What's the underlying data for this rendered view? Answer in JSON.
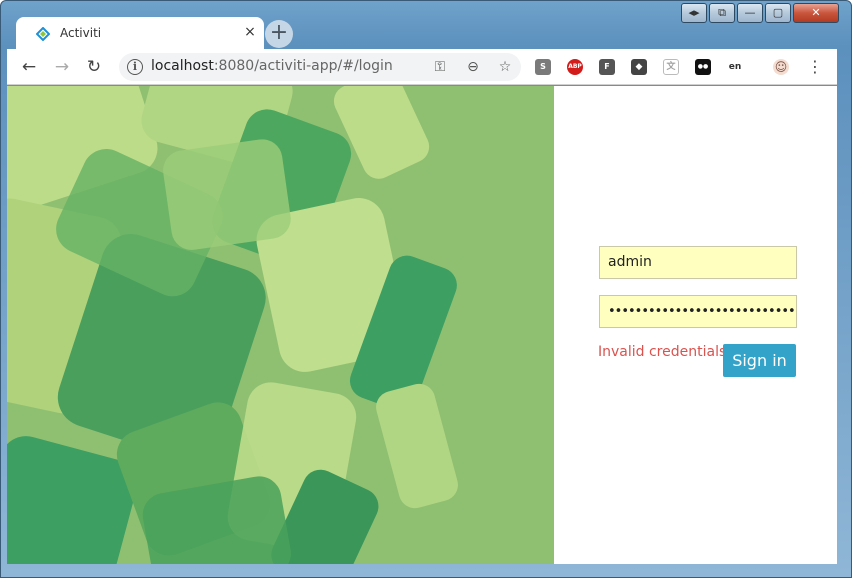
{
  "browser": {
    "tab": {
      "title": "Activiti",
      "close_glyph": "×"
    },
    "new_tab_glyph": "+",
    "window_controls": {
      "restore_label": "◂▸",
      "pin_label": "⧉",
      "minimize_label": "—",
      "maximize_label": "▢",
      "close_label": "✕"
    },
    "nav": {
      "back": "←",
      "forward": "→",
      "reload": "↻"
    },
    "url": {
      "host": "localhost",
      "path": ":8080/activiti-app/#/login"
    },
    "omnibox_icons": {
      "info": "i",
      "key": "⚿",
      "zoom": "⊖",
      "star": "☆"
    },
    "extensions": [
      {
        "name": "s-extension-icon",
        "label": "S",
        "color": "#7a7a7a"
      },
      {
        "name": "adblock-plus-icon",
        "label": "ABP",
        "color": "#d21b1b"
      },
      {
        "name": "f-extension-icon",
        "label": "F",
        "color": "#555555"
      },
      {
        "name": "diamond-extension-icon",
        "label": "◆",
        "color": "#444444"
      },
      {
        "name": "translate-extension-icon",
        "label": "文",
        "color": "#a0a0a0"
      },
      {
        "name": "tampermonkey-icon",
        "label": "●●",
        "color": "#111111"
      },
      {
        "name": "english-extension-icon",
        "label": "en",
        "color": "#333333"
      },
      {
        "name": "avatar-extension-icon",
        "label": "☺",
        "color": "#e7b8a5"
      }
    ],
    "menu_glyph": "⋮"
  },
  "login": {
    "username_value": "admin",
    "password_value": "••••••••••••••••••••••••••••••••",
    "error_text": "Invalid credentials",
    "signin_label": "Sign in"
  },
  "colors": {
    "hero_background": "#8fc072",
    "field_background": "#ffffc0",
    "error": "#d9534f",
    "signin_button": "#33a3c9"
  }
}
